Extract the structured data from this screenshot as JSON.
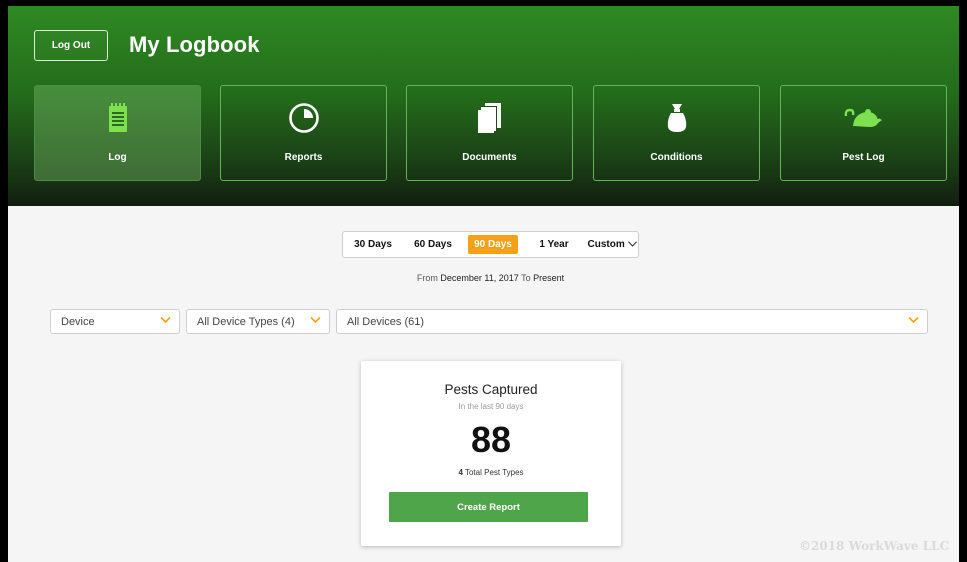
{
  "header": {
    "logout_label": "Log Out",
    "title": "My Logbook"
  },
  "nav": [
    {
      "label": "Log",
      "icon": "notepad-icon",
      "active": true
    },
    {
      "label": "Reports",
      "icon": "pie-chart-icon",
      "active": false
    },
    {
      "label": "Documents",
      "icon": "documents-icon",
      "active": false
    },
    {
      "label": "Conditions",
      "icon": "bag-icon",
      "active": false
    },
    {
      "label": "Pest Log",
      "icon": "rodent-icon",
      "active": false
    }
  ],
  "range": {
    "options": [
      "30 Days",
      "60 Days",
      "90 Days",
      "1 Year",
      "Custom"
    ],
    "selected": "90 Days",
    "from_prefix": "From",
    "from_date": "December 11, 2017",
    "to_label": "To",
    "to_value": "Present"
  },
  "filters": {
    "device": "Device",
    "device_types": "All Device Types (4)",
    "devices": "All Devices (61)"
  },
  "card": {
    "title": "Pests Captured",
    "subtitle": "In the last 90 days",
    "count": "88",
    "types_count": "4",
    "types_label": "Total Pest Types",
    "button_label": "Create Report"
  },
  "footer": {
    "copyright": "©2018 WorkWave LLC"
  },
  "colors": {
    "accent_orange": "#f4a019",
    "button_green": "#4ea54a",
    "header_green": "#2f8a23",
    "icon_green": "#7ee04f"
  }
}
